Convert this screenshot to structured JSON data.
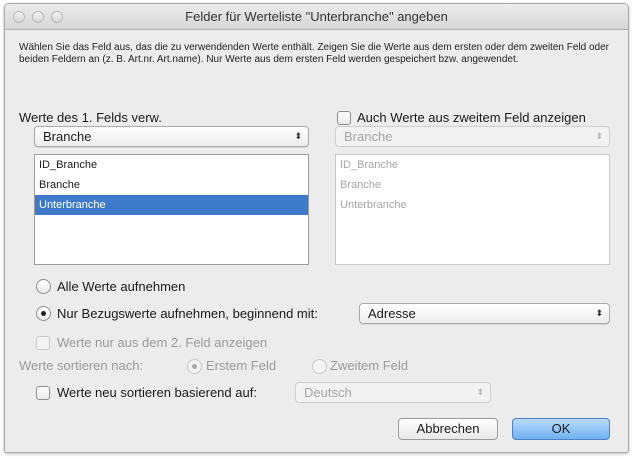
{
  "window": {
    "title": "Felder für Werteliste \"Unterbranche\" angeben"
  },
  "description": "Wählen Sie das Feld aus, das die zu verwendenden Werte enthält.  Zeigen Sie die Werte aus dem ersten oder dem zweiten Feld oder beiden Feldern an (z. B. Art.nr. Art.name). Nur Werte aus dem ersten Feld werden gespeichert bzw. angewendet.",
  "first_field": {
    "label": "Werte des 1. Felds verw.",
    "selected": "Branche",
    "items": [
      "ID_Branche",
      "Branche",
      "Unterbranche"
    ],
    "selected_item": "Unterbranche"
  },
  "second_field": {
    "checkbox_label": "Auch Werte aus zweitem Feld anzeigen",
    "checked": false,
    "selected": "Branche",
    "items": [
      "ID_Branche",
      "Branche",
      "Unterbranche"
    ]
  },
  "options": {
    "all_values_label": "Alle Werte aufnehmen",
    "related_values_label": "Nur Bezugswerte aufnehmen, beginnend mit:",
    "related_selected": "Adresse",
    "second_only_label": "Werte nur aus dem 2. Feld anzeigen",
    "sort_label": "Werte sortieren nach:",
    "sort_first_label": "Erstem Feld",
    "sort_second_label": "Zweitem Feld",
    "resort_label": "Werte neu sortieren basierend auf:",
    "resort_language": "Deutsch"
  },
  "buttons": {
    "cancel": "Abbrechen",
    "ok": "OK"
  },
  "colors": {
    "selection": "#3d7ac9",
    "default_button": "#6fb0f0"
  }
}
